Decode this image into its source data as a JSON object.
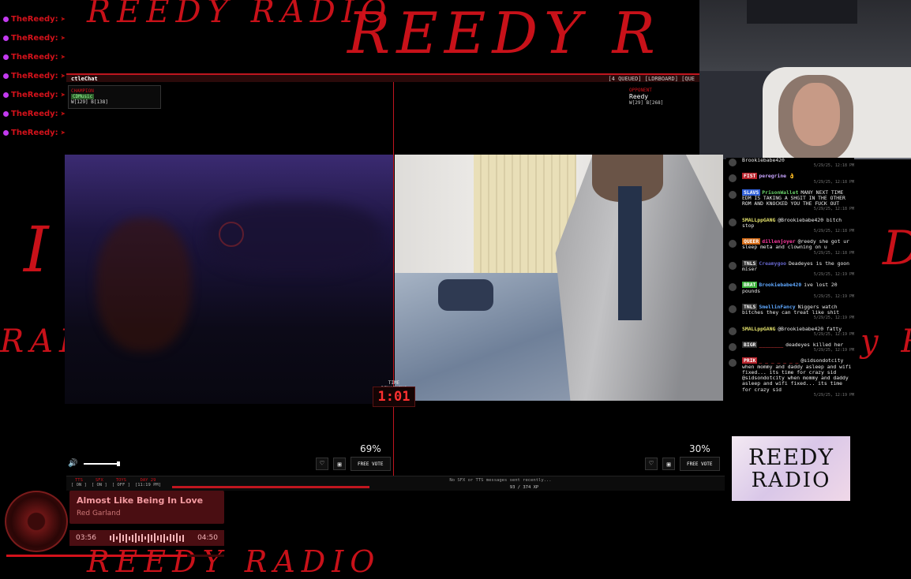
{
  "background_text": {
    "top": "REEDY RADIO",
    "top_right": "REEDY R",
    "left_mid": "I",
    "left_radio": "RADIO",
    "right_d": "D",
    "right_y": "y R",
    "bottom": "REEDY RADIO"
  },
  "left_strip": {
    "names": [
      "TheReedy:",
      "TheReedy:",
      "TheReedy:",
      "TheReedy:",
      "TheReedy:",
      "TheReedy:",
      "TheReedy:"
    ]
  },
  "battle": {
    "title": "ctleChat",
    "header_right": "[4 QUEUED] [LDRBOARD] [QUE",
    "champion_label": "CHAMPION",
    "champion_name": "CDMusic",
    "champion_stats": "W[129] B[138]",
    "opponent_label": "OPPONENT",
    "opponent_name": "Reedy",
    "opponent_stats": "W[29] B[268]",
    "timer_label": "TIME REMAINING",
    "timer": "1:01",
    "left_percent": "69%",
    "right_percent": "30%",
    "free_vote_left": "FREE VOTE",
    "free_vote_right": "FREE VOTE"
  },
  "icons": {
    "heart": "♡",
    "bag": "🛍",
    "volume": "🔊"
  },
  "status_bar": {
    "tts_key": "TTS",
    "tts_val": "[ ON ]",
    "sfx_key": "SFX",
    "sfx_val": "[ ON ]",
    "toys_key": "TOYS",
    "toys_val": "[ OFF ]",
    "day_key": "DAY 29",
    "day_val": "[11:19 PM]",
    "message": "No SFX or TTS messages sent recently...",
    "xp": "93 / 374 XP"
  },
  "now_playing": {
    "title": "Almost Like Being In Love",
    "artist": "Red Garland",
    "current_time": "03:56",
    "total_time": "04:50",
    "progress": 0.83
  },
  "chat": [
    {
      "badge": "",
      "badge_color": "",
      "user": "",
      "user_color": "#ccc",
      "text": "Brookiebabe420",
      "ts": "5/29/25, 12:18 PM"
    },
    {
      "badge": "FIST",
      "badge_color": "#b8232c",
      "user": "peregrine",
      "user_color": "#c9a5ff",
      "text": "👌",
      "ts": "5/29/25, 12:18 PM"
    },
    {
      "badge": "SLAVS",
      "badge_color": "#2f5ed6",
      "user": "PrisonWallet",
      "user_color": "#6ad36a",
      "text": "MANY NEXT TIME EDM IS TAKING A SHGIT IN THE OTHER ROM AND KNOCKED YOU THE FUCK OUT",
      "ts": "5/29/25, 12:18 PM"
    },
    {
      "badge": "",
      "badge_color": "",
      "user": "SMALLppGANG",
      "user_color": "#e5e36c",
      "text": "@Brookiebabe420 bitch stop",
      "ts": "5/29/25, 12:18 PM"
    },
    {
      "badge": "QUEER",
      "badge_color": "#d36a16",
      "user": "dillenjoyer",
      "user_color": "#ff3aa0",
      "text": "@reedy she got ur sleep meta and clowning on u",
      "ts": "5/29/25, 12:18 PM"
    },
    {
      "badge": "TNLS",
      "badge_color": "#333",
      "user": "Creamygoo",
      "user_color": "#66c",
      "text": "Deadeyes is the goon miser",
      "ts": "5/29/25, 12:19 PM"
    },
    {
      "badge": "BRAT",
      "badge_color": "#3ab03a",
      "user": "Brookiebabe420",
      "user_color": "#5fa8ff",
      "text": "ive lost 20 pounds",
      "ts": "5/29/25, 12:19 PM"
    },
    {
      "badge": "TNLS",
      "badge_color": "#333",
      "user": "SmellinFancy",
      "user_color": "#5fa8ff",
      "text": "Niggers watch bitches they can treat like shit",
      "ts": "5/29/25, 12:19 PM"
    },
    {
      "badge": "",
      "badge_color": "",
      "user": "SMALLppGANG",
      "user_color": "#e5e36c",
      "text": "@Brookiebabe420 fatty",
      "ts": "5/29/25, 12:19 PM"
    },
    {
      "badge": "BIGR",
      "badge_color": "#333",
      "user": "________",
      "user_color": "#b03030",
      "text": "deadeyes killed her",
      "ts": "5/29/25, 12:19 PM"
    },
    {
      "badge": "PRIK",
      "badge_color": "#b8232c",
      "user": "_ _ _ _ _ _ _",
      "user_color": "#b03030",
      "text": "@sidsondotcity when mommy and daddy asleep and wifi fixed... its time for crazy sid @sidsondotcity when mommy and daddy asleep and wifi fixed... its time for crazy sid",
      "ts": "5/29/25, 12:19 PM"
    }
  ],
  "logo": {
    "line1": "REEDY",
    "line2": "RADIO"
  },
  "colors": {
    "accent": "#d3121b",
    "panel": "#0c0c0c"
  }
}
